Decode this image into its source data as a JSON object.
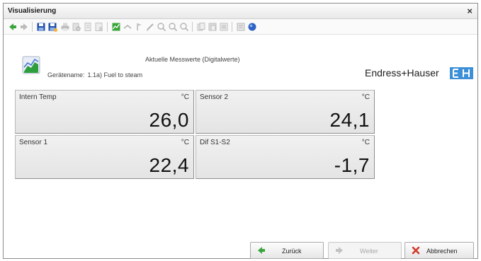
{
  "window": {
    "title": "Visualisierung",
    "close_label": "×"
  },
  "toolbar": {
    "icons": [
      "back-arrow-icon",
      "forward-arrow-icon",
      "save-icon",
      "save-as-icon",
      "print-icon",
      "print-preview-icon",
      "page-icon",
      "page-setup-icon",
      "chart-icon",
      "connect-icon",
      "pin-icon",
      "pen-icon",
      "zoom-in-icon",
      "zoom-out-icon",
      "zoom-reset-icon",
      "copy-icon",
      "paste-icon",
      "export-icon",
      "notes-icon",
      "help-icon"
    ]
  },
  "header": {
    "title": "Aktuelle Messwerte (Digitalwerte)",
    "device_label": "Gerätename:",
    "device_value": "1.1a) Fuel to steam",
    "logo_text": "Endress+Hauser"
  },
  "tiles": [
    {
      "name": "Intern Temp",
      "unit": "°C",
      "value": "26,0"
    },
    {
      "name": "Sensor 2",
      "unit": "°C",
      "value": "24,1"
    },
    {
      "name": "Sensor 1",
      "unit": "°C",
      "value": "22,4"
    },
    {
      "name": "Dif S1-S2",
      "unit": "°C",
      "value": "-1,7"
    }
  ],
  "buttons": {
    "back": "Zurück",
    "next": "Weiter",
    "cancel": "Abbrechen"
  },
  "colors": {
    "accent_green": "#3aa53a",
    "save_blue": "#1f4fa8",
    "logo_blue": "#3d8fd8",
    "cancel_red": "#d23a2a"
  }
}
